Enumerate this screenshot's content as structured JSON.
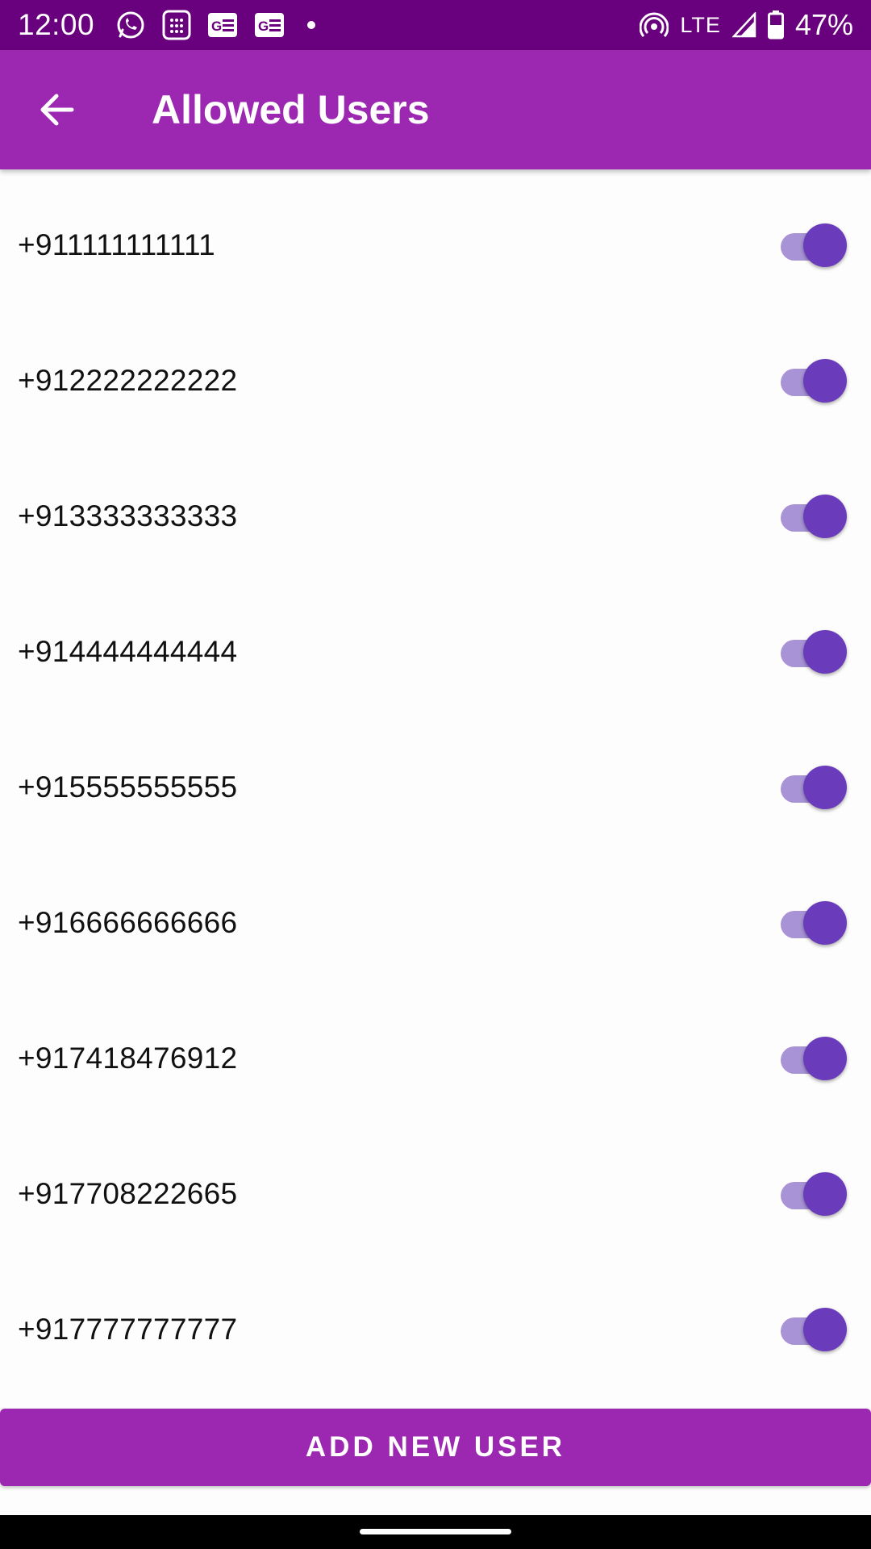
{
  "status_bar": {
    "time": "12:00",
    "network": "LTE",
    "battery": "47%",
    "icons_left": [
      "whatsapp-icon",
      "calculator-icon",
      "news-icon",
      "news-icon",
      "notification-dot"
    ],
    "icons_right": [
      "hotspot-icon",
      "signal-icon",
      "battery-icon"
    ]
  },
  "app_bar": {
    "title": "Allowed Users",
    "back_icon": "arrow-back-icon"
  },
  "users": [
    {
      "phone": "+911111111111",
      "enabled": true
    },
    {
      "phone": "+912222222222",
      "enabled": true
    },
    {
      "phone": "+913333333333",
      "enabled": true
    },
    {
      "phone": "+914444444444",
      "enabled": true
    },
    {
      "phone": "+915555555555",
      "enabled": true
    },
    {
      "phone": "+916666666666",
      "enabled": true
    },
    {
      "phone": "+917418476912",
      "enabled": true
    },
    {
      "phone": "+917708222665",
      "enabled": true
    },
    {
      "phone": "+917777777777",
      "enabled": true
    }
  ],
  "actions": {
    "add_user_label": "ADD NEW USER"
  },
  "colors": {
    "status_bar": "#69007d",
    "app_bar": "#9c27b0",
    "toggle_thumb": "#6a3cbc",
    "toggle_track": "#a793d6"
  }
}
